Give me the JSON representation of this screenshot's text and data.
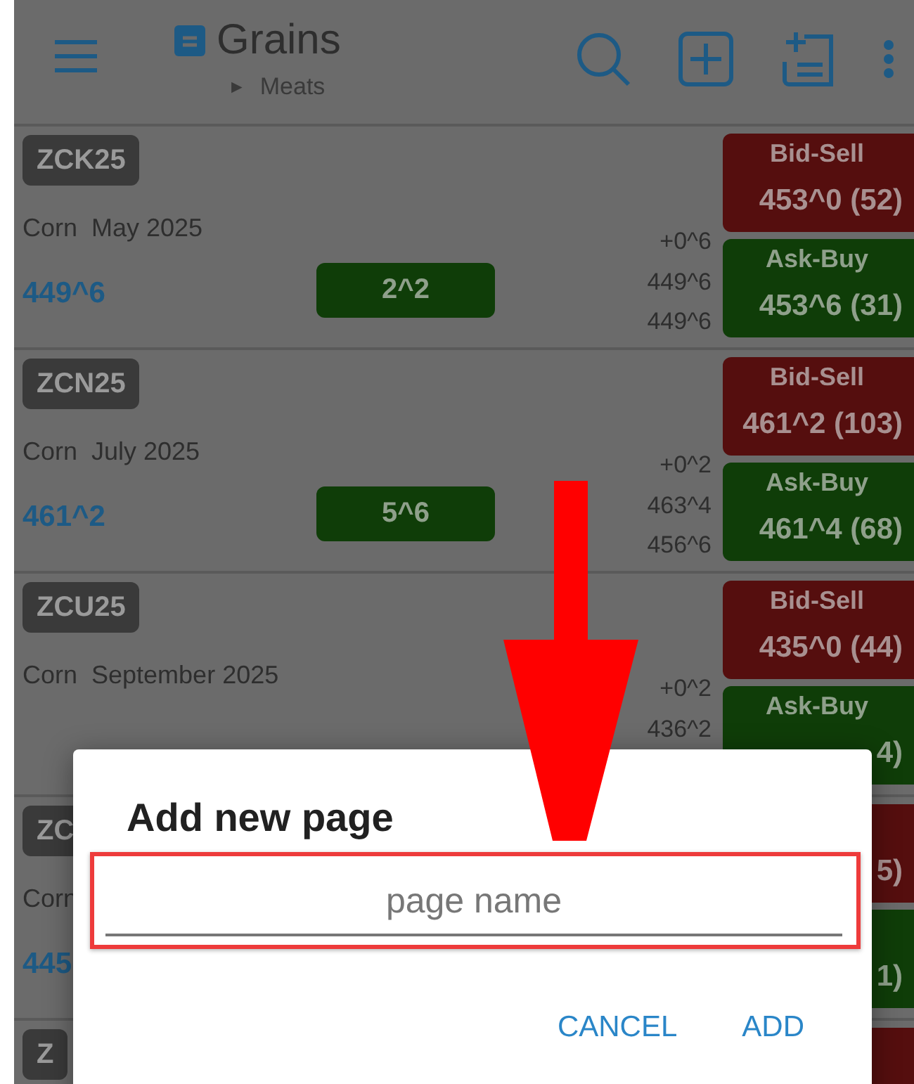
{
  "toolbar": {
    "title": "Grains",
    "subtitle_marker": "►",
    "subtitle": "Meats"
  },
  "contracts": [
    {
      "ticker": "ZCK25",
      "name": "Corn  May 2025",
      "price": "449^6",
      "change": "2^2",
      "net": "+0^6",
      "high": "449^6",
      "low": "449^6",
      "bid_label": "Bid-Sell",
      "bid": "453^0 (52)",
      "ask_label": "Ask-Buy",
      "ask": "453^6 (31)"
    },
    {
      "ticker": "ZCN25",
      "name": "Corn  July 2025",
      "price": "461^2",
      "change": "5^6",
      "net": "+0^2",
      "high": "463^4",
      "low": "456^6",
      "bid_label": "Bid-Sell",
      "bid": "461^2 (103)",
      "ask_label": "Ask-Buy",
      "ask": "461^4 (68)"
    },
    {
      "ticker": "ZCU25",
      "name": "Corn  September 2025",
      "net": "+0^2",
      "high": "436^2",
      "bid_label": "Bid-Sell",
      "bid": "435^0 (44)",
      "ask_label": "Ask-Buy",
      "ask": "4)"
    },
    {
      "ticker": "ZC",
      "name": "Corn",
      "price": "445",
      "bid": "5)",
      "ask": "1)"
    },
    {
      "ticker": "Z"
    }
  ],
  "dialog": {
    "title": "Add new page",
    "field": {
      "placeholder": "page name"
    },
    "buttons": [
      "CANCEL",
      "ADD"
    ]
  }
}
